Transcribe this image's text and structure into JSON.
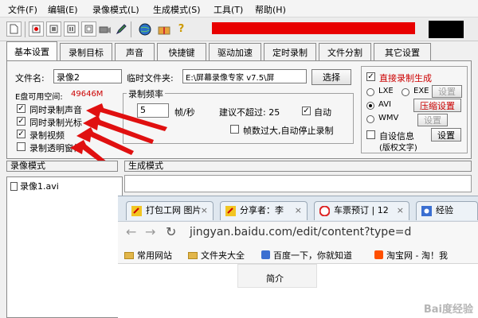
{
  "menu": {
    "items": [
      "文件(F)",
      "编辑(E)",
      "录像模式(L)",
      "生成模式(S)",
      "工具(T)",
      "帮助(H)"
    ]
  },
  "toolbar": {
    "icons": [
      "new-icon",
      "record-icon",
      "stop-icon",
      "pause-icon",
      "camera-icon",
      "pen-icon",
      "globe-icon",
      "gift-icon",
      "help-icon"
    ],
    "help_glyph": "?",
    "brand_color": "#e80000"
  },
  "tabs": [
    "基本设置",
    "录制目标",
    "声音",
    "快捷键",
    "驱动加速",
    "定时录制",
    "文件分割",
    "其它设置"
  ],
  "basic": {
    "filename_label": "文件名:",
    "filename_value": "录像2",
    "temp_folder_label": "临时文件夹:",
    "temp_folder_value": "E:\\屏幕录像专家 v7.5\\屏",
    "choose_button": "选择",
    "disk_space_label": "E盘可用空间:",
    "disk_space_value": "49646M",
    "checkboxes": [
      {
        "label": "同时录制声音",
        "checked": true
      },
      {
        "label": "同时录制光标",
        "checked": true
      },
      {
        "label": "录制视频",
        "checked": true
      },
      {
        "label": "录制透明窗体",
        "checked": false
      }
    ],
    "frame_rate": {
      "title": "录制频率",
      "value": "5",
      "unit": "帧/秒",
      "hint": "建议不超过: 25",
      "auto_label": "自动",
      "auto_checked": true,
      "auto_stop_label": "帧数过大,自动停止录制",
      "auto_stop_checked": false
    },
    "direct_gen": {
      "label": "直接录制生成",
      "checked": true,
      "formats": [
        {
          "label": "LXE",
          "selected": false
        },
        {
          "label": "EXE",
          "selected": false
        },
        {
          "label": "AVI",
          "selected": true
        },
        {
          "label": "WMV",
          "selected": false
        }
      ],
      "settings_button": "设置",
      "compress_button": "压缩设置",
      "custom_info_label": "自设信息",
      "custom_info_sub": "(版权文字)",
      "custom_info_checked": false,
      "custom_settings_button": "设置"
    }
  },
  "sections": {
    "record_mode": "录像模式",
    "gen_mode": "生成模式"
  },
  "file_list": [
    "录像1.avi"
  ],
  "browser": {
    "tabs": [
      "打包工网 图片",
      "分享者：李",
      "车票预订 | 12",
      "经验"
    ],
    "url": "jingyan.baidu.com/edit/content?type=d",
    "bookmarks": [
      "常用网站",
      "文件夹大全",
      "百度一下，你就知道",
      "淘宝网 - 淘！我"
    ],
    "content_text": "简介",
    "watermark": "Bai度经验"
  }
}
